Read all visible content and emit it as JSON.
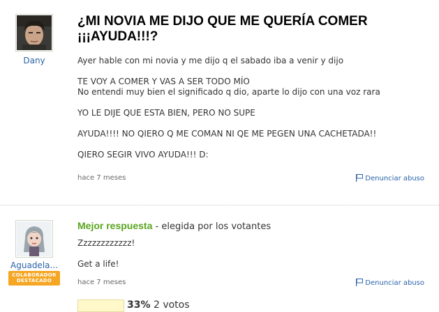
{
  "question": {
    "user": {
      "name": "Dany"
    },
    "title": "¿MI NOVIA ME DIJO QUE ME QUERÍA COMER ¡¡¡AYUDA!!!?",
    "body": [
      "Ayer hable con mi novia y me dijo q el sabado iba a venir y dijo",
      "TE VOY A COMER Y VAS A SER TODO MÍO",
      "No entendi muy bien el significado q dio, aparte lo dijo con una voz rara",
      "YO LE DIJE QUE ESTA BIEN, PERO NO SUPE",
      "AYUDA!!!! NO QIERO Q ME COMAN NI QE ME PEGEN UNA CACHETADA!!",
      "QIERO SEGIR VIVO AYUDA!!! D:"
    ],
    "time": "hace 7 meses",
    "report": "Denunciar abuso"
  },
  "answer": {
    "user": {
      "name": "Aguadela..."
    },
    "badge": {
      "line1": "COLABORADOR",
      "line2": "DESTACADO"
    },
    "best_label": "Mejor respuesta",
    "best_suffix": "- elegida por los votantes",
    "body": [
      "Zzzzzzzzzzzz!",
      "Get a life!"
    ],
    "time": "hace 7 meses",
    "report": "Denunciar abuso",
    "votes": {
      "percent": "33%",
      "count": "2 votos",
      "fraction": 0.33
    }
  },
  "colors": {
    "link": "#2a63a8",
    "best": "#5aa520",
    "badge": "#f5a623"
  },
  "icons": [
    "flag-icon"
  ]
}
